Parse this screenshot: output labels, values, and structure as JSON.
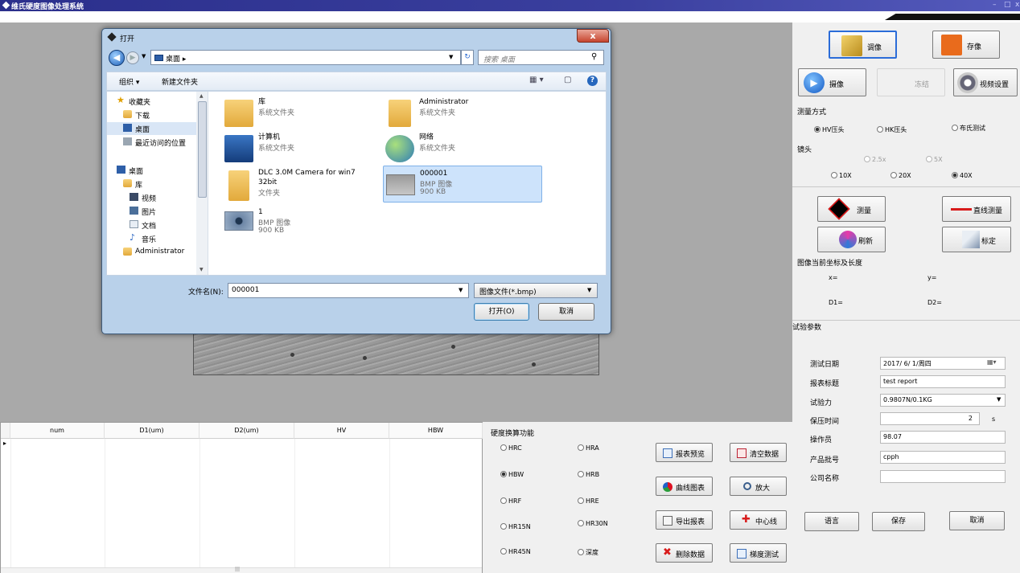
{
  "app": {
    "title": "维氏硬度图像处理系统",
    "minimize": "–",
    "maximize": "□",
    "close": "x"
  },
  "dialog": {
    "title": "打开",
    "close": "x",
    "address": "桌面",
    "address_arrow": "▸",
    "search_placeholder": "搜索 桌面",
    "toolbar": {
      "organize": "组织 ▾",
      "new_folder": "新建文件夹"
    },
    "nav": {
      "favorites": "收藏夹",
      "downloads": "下载",
      "desktop": "桌面",
      "recent": "最近访问的位置",
      "desktop2": "桌面",
      "library": "库",
      "video": "视频",
      "pictures": "图片",
      "docs": "文档",
      "music": "音乐",
      "admin": "Administrator"
    },
    "files": [
      {
        "name": "库",
        "type": "系统文件夹"
      },
      {
        "name": "Administrator",
        "type": "系统文件夹"
      },
      {
        "name": "计算机",
        "type": "系统文件夹"
      },
      {
        "name": "网络",
        "type": "系统文件夹"
      },
      {
        "name": "DLC 3.0M Camera for win7 32bit",
        "type": "文件夹"
      },
      {
        "name": "000001",
        "type": "BMP 图像",
        "size": "900 KB"
      },
      {
        "name": "1",
        "type": "BMP 图像",
        "size": "900 KB"
      }
    ],
    "filename_label": "文件名(N):",
    "filename_value": "000001",
    "filetype": "图像文件(*.bmp)",
    "open_button": "打开(O)",
    "cancel_button": "取消"
  },
  "right": {
    "btn_acquire": "调像",
    "btn_save_image": "存像",
    "btn_capture": "摄像",
    "btn_freeze": "冻结",
    "btn_video_settings": "视频设置",
    "measure_mode_label": "测量方式",
    "measure_modes": [
      "HV压头",
      "HK压头",
      "布氏测试"
    ],
    "lens_label": "镜头",
    "lens_disabled": [
      "2.5x",
      "5X"
    ],
    "lens": [
      "10X",
      "20X",
      "40X"
    ],
    "btn_measure": "测量",
    "btn_line_measure": "直线测量",
    "btn_refresh": "刷新",
    "btn_calibrate": "标定",
    "coord_label": "图像当前坐标及长度",
    "x_label": "x=",
    "y_label": "y=",
    "d1_label": "D1=",
    "d2_label": "D2=",
    "test_params_label": "试验参数",
    "params": {
      "date_label": "测试日期",
      "date_value": "2017/ 6/ 1/周四",
      "title_label": "报表标题",
      "title_value": "test report",
      "force_label": "试验力",
      "force_value": "0.9807N/0.1KG",
      "hold_label": "保压时间",
      "hold_value": "2",
      "hold_unit": "s",
      "operator_label": "操作员",
      "operator_value": "98.07",
      "batch_label": "产品批号",
      "batch_value": "cpph",
      "company_label": "公司名称",
      "company_value": ""
    },
    "btn_language": "语言",
    "btn_save": "保存",
    "btn_cancel": "取消"
  },
  "grid": {
    "columns": [
      "num",
      "D1(um)",
      "D2(um)",
      "HV",
      "HBW"
    ],
    "row_marker": "▸",
    "scroll_mark": "|||"
  },
  "conversion": {
    "label": "硬度换算功能",
    "left": [
      "HRC",
      "HBW",
      "HRF",
      "HR15N",
      "HR45N"
    ],
    "right": [
      "HRA",
      "HRB",
      "HRE",
      "HR30N",
      "深度"
    ],
    "selected": "HBW"
  },
  "actions": {
    "report_preview": "报表预览",
    "clear_data": "清空数据",
    "curve_chart": "曲线图表",
    "zoom_in": "放大",
    "export_report": "导出报表",
    "center_line": "中心线",
    "delete_data": "删除数据",
    "gradient_test": "梯度测试"
  },
  "colors": {
    "titlebar": "#2b2f8c",
    "accent_blue": "#2b6cd8",
    "workspace": "#a9a9a9"
  }
}
